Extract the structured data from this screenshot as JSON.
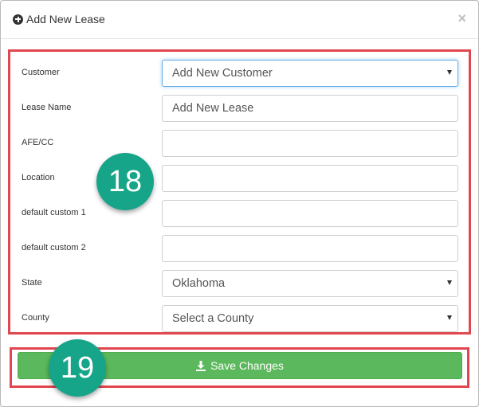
{
  "header": {
    "title": "Add New Lease",
    "icon": "plus-circle-icon",
    "close_label": "×"
  },
  "form": {
    "fields": [
      {
        "label": "Customer",
        "type": "select",
        "value": "Add New Customer"
      },
      {
        "label": "Lease Name",
        "type": "text",
        "value": "",
        "placeholder": "Add New Lease"
      },
      {
        "label": "AFE/CC",
        "type": "text",
        "value": ""
      },
      {
        "label": "Location",
        "type": "text",
        "value": ""
      },
      {
        "label": "default custom 1",
        "type": "text",
        "value": ""
      },
      {
        "label": "default custom 2",
        "type": "text",
        "value": ""
      },
      {
        "label": "State",
        "type": "select",
        "value": "Oklahoma"
      },
      {
        "label": "County",
        "type": "select",
        "value": "Select a County"
      }
    ]
  },
  "footer": {
    "save_label": "Save Changes",
    "save_icon": "download-icon",
    "save_color": "#5cb85c"
  },
  "annotations": {
    "badge_18": "18",
    "badge_19": "19",
    "highlight_color": "#e0474f",
    "badge_color": "#17a589"
  }
}
